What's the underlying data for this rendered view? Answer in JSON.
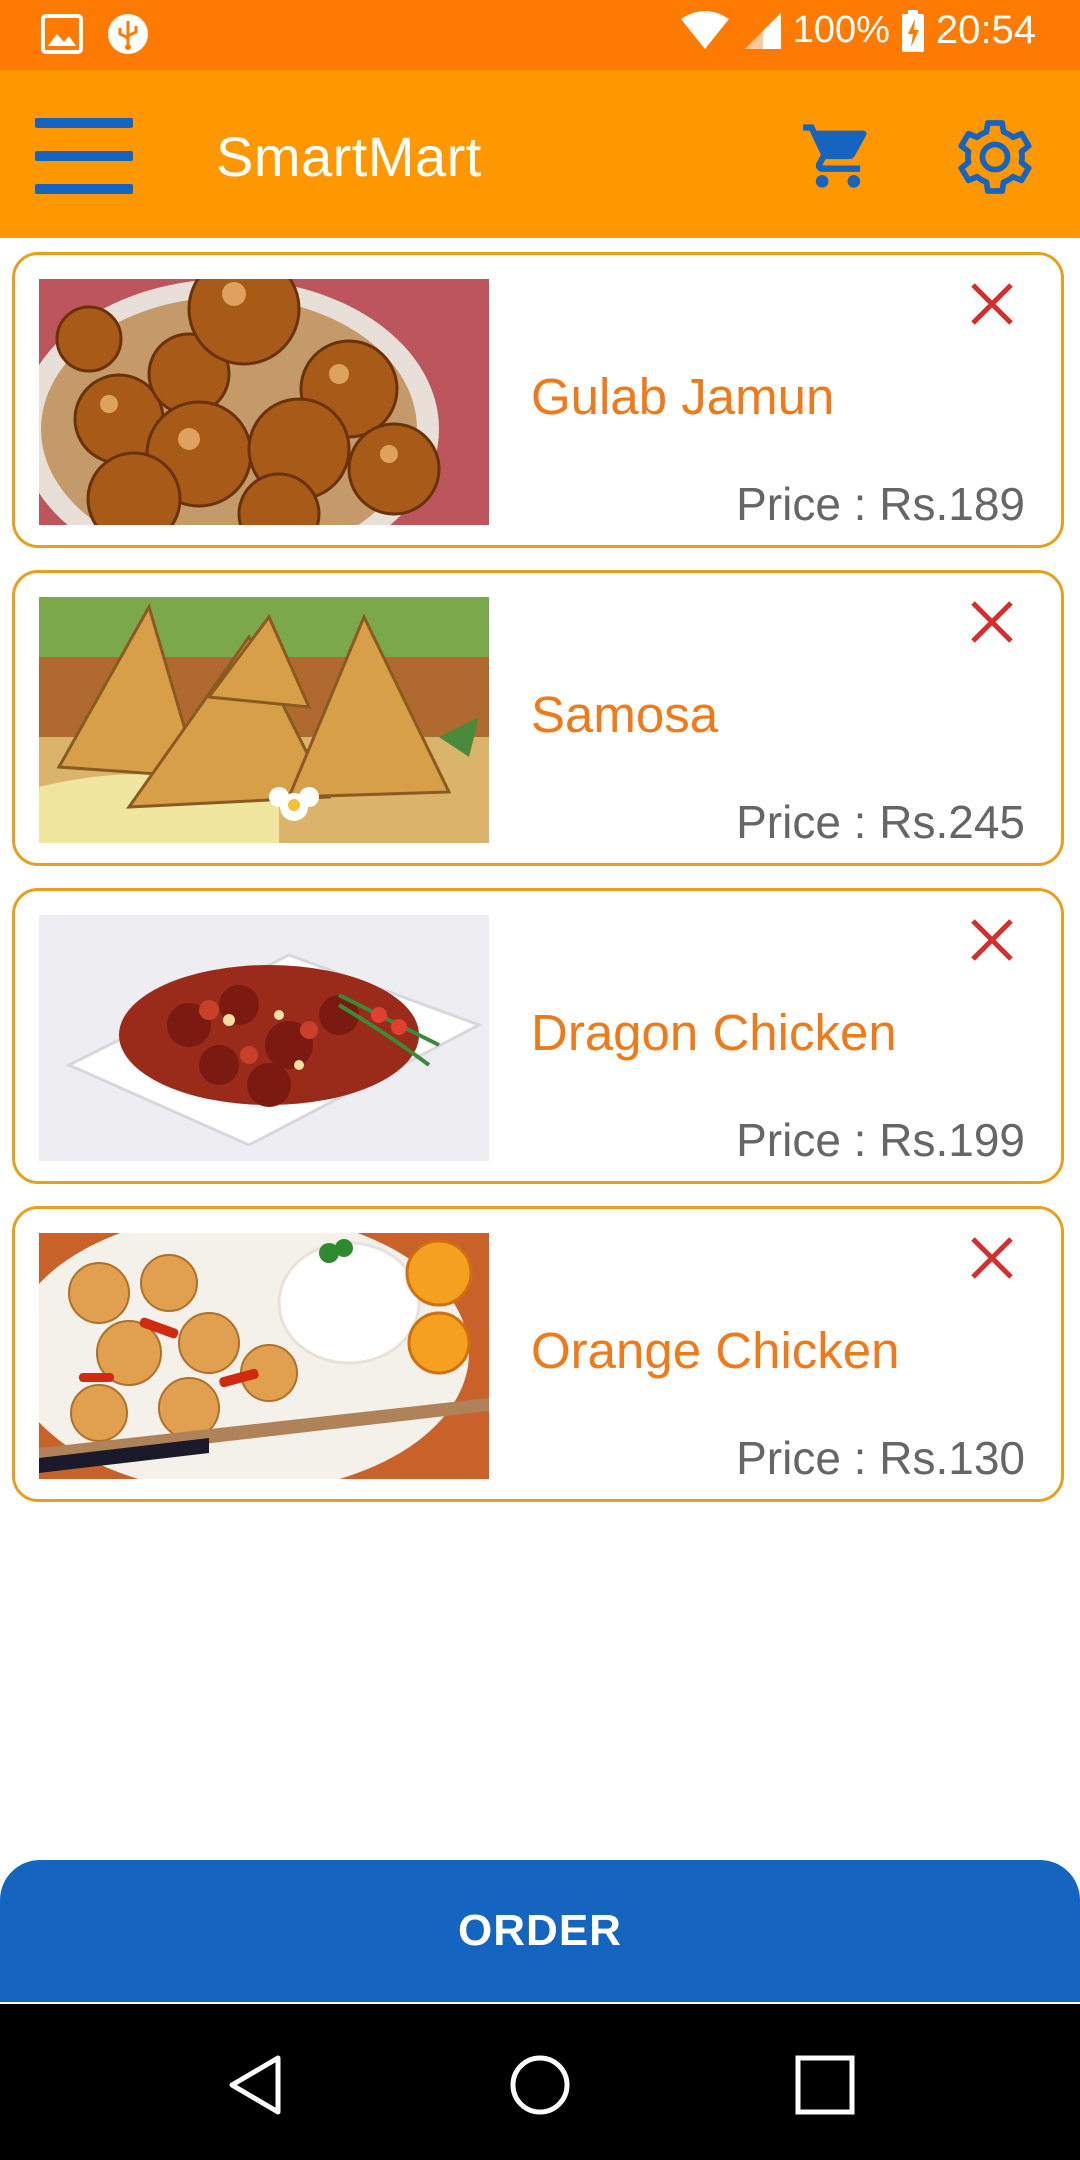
{
  "status_bar": {
    "battery_percent": "100%",
    "time": "20:54",
    "icons": [
      "image-icon",
      "usb-icon",
      "wifi-icon",
      "signal-icon",
      "battery-charging-icon"
    ]
  },
  "app_bar": {
    "title": "SmartMart",
    "menu_icon": "hamburger-menu-icon",
    "cart_icon": "shopping-cart-icon",
    "settings_icon": "gear-icon"
  },
  "cart_items": [
    {
      "name": "Gulab Jamun",
      "price_label": "Price : Rs.189",
      "image": "gulab-jamun-photo"
    },
    {
      "name": "Samosa",
      "price_label": "Price : Rs.245",
      "image": "samosa-photo"
    },
    {
      "name": "Dragon Chicken",
      "price_label": "Price : Rs.199",
      "image": "dragon-chicken-photo"
    },
    {
      "name": "Orange Chicken",
      "price_label": "Price : Rs.130",
      "image": "orange-chicken-photo"
    }
  ],
  "order_button": {
    "label": "ORDER"
  },
  "colors": {
    "status_bar": "#ff7a00",
    "app_bar": "#ff9800",
    "accent_blue": "#1565c0",
    "item_name": "#ef7a1a",
    "card_border": "#e6a01e",
    "remove_icon": "#d32f2f"
  }
}
